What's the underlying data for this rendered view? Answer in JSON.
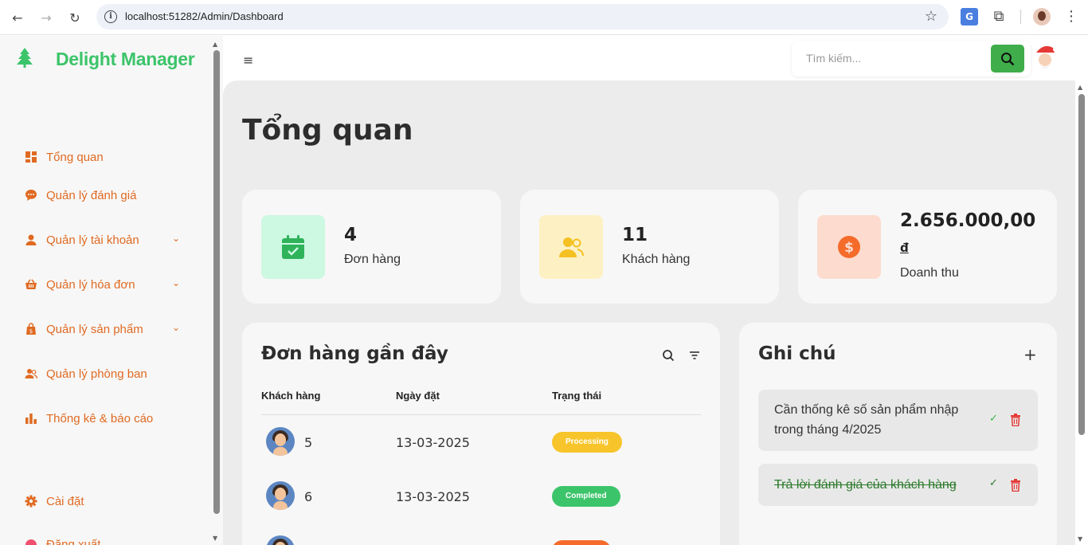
{
  "browser": {
    "url": "localhost:51282/Admin/Dashboard",
    "translate_label": "G"
  },
  "sidebar": {
    "brand": "Delight Manager",
    "items": [
      {
        "label": "Tổng quan",
        "icon": "dashboard-icon"
      },
      {
        "label": "Quản lý đánh giá",
        "icon": "chat-bubble-icon"
      },
      {
        "label": "Quản lý tài khoản",
        "icon": "user-icon",
        "expandable": true
      },
      {
        "label": "Quản lý hóa đơn",
        "icon": "basket-icon",
        "expandable": true
      },
      {
        "label": "Quản lý sản phẩm",
        "icon": "shopping-bag-icon",
        "expandable": true
      },
      {
        "label": "Quản lý phòng ban",
        "icon": "users-icon"
      },
      {
        "label": "Thống kê & báo cáo",
        "icon": "bar-chart-icon"
      }
    ],
    "settings": "Cài đặt",
    "logout": "Đăng xuất"
  },
  "search": {
    "placeholder": "Tìm kiếm..."
  },
  "page": {
    "title": "Tổng quan"
  },
  "stats": [
    {
      "value": "4",
      "label": "Đơn hàng",
      "color": "#3cc46a",
      "bg": "#cdf8e2"
    },
    {
      "value": "11",
      "label": "Khách hàng",
      "color": "#f5c022",
      "bg": "#fdf1c4"
    },
    {
      "value": "2.656.000,00",
      "currency": "đ",
      "label": "Doanh thu",
      "color": "#f56b2a",
      "bg": "#fddccf"
    }
  ],
  "orders": {
    "title": "Đơn hàng gần đây",
    "columns": [
      "Khách hàng",
      "Ngày đặt",
      "Trạng thái"
    ],
    "rows": [
      {
        "customer": "5",
        "date": "13-03-2025",
        "status": "Processing",
        "status_color": "#f7c52b"
      },
      {
        "customer": "6",
        "date": "13-03-2025",
        "status": "Completed",
        "status_color": "#3cc46a"
      },
      {
        "customer": "",
        "date": "",
        "status": "",
        "status_color": "#f56b2a"
      }
    ]
  },
  "notes": {
    "title": "Ghi chú",
    "items": [
      {
        "text": "Cần thống kê số sản phẩm nhập trong tháng 4/2025",
        "done": false
      },
      {
        "text": "Trả lời đánh giá của khách hàng",
        "done": true
      }
    ]
  }
}
